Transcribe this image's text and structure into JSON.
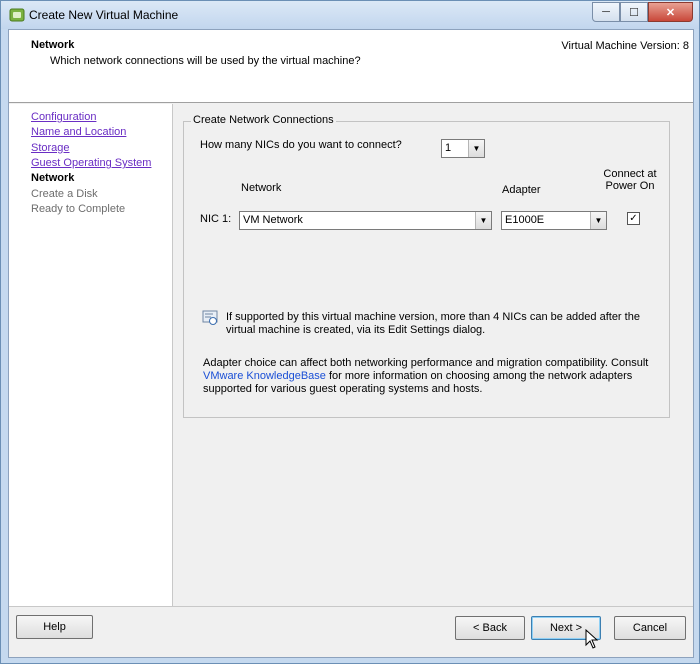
{
  "window": {
    "title": "Create New Virtual Machine",
    "controls": {
      "minimize": "─",
      "maximize": "☐",
      "close": "✕"
    }
  },
  "header": {
    "title": "Network",
    "subtitle": "Which network connections will be used by the virtual machine?",
    "version": "Virtual Machine Version: 8"
  },
  "steps": [
    {
      "label": "Configuration",
      "state": "link"
    },
    {
      "label": "Name and Location",
      "state": "link"
    },
    {
      "label": "Storage",
      "state": "link"
    },
    {
      "label": "Guest Operating System",
      "state": "link"
    },
    {
      "label": "Network",
      "state": "current"
    },
    {
      "label": "Create a Disk",
      "state": "future"
    },
    {
      "label": "Ready to Complete",
      "state": "future"
    }
  ],
  "group": {
    "legend": "Create Network Connections",
    "nic_question": "How many NICs do you want to connect?",
    "nic_count": "1",
    "col_network": "Network",
    "col_adapter": "Adapter",
    "col_connect_line1": "Connect at",
    "col_connect_line2": "Power On",
    "nic_label": "NIC 1:",
    "network_value": "VM Network",
    "adapter_value": "E1000E",
    "connect_checked": true,
    "checkmark": "✓",
    "info_line1": "If supported by this virtual machine version, more than 4 NICs can be added after the",
    "info_line2": "virtual machine is created, via its Edit Settings dialog.",
    "adapter_line1": "Adapter choice can affect both networking performance and migration compatibility. Consult",
    "adapter_link": "VMware KnowledgeBase",
    "adapter_line2_rest": " for more information on choosing among the network adapters",
    "adapter_line3": "supported for various guest operating systems and hosts."
  },
  "buttons": {
    "help": "Help",
    "back": "< Back",
    "next": "Next >",
    "cancel": "Cancel"
  },
  "colors": {
    "link": "#6a2ec4",
    "kb_link": "#1a4fd6",
    "title_bar": "#c5d9ef"
  }
}
